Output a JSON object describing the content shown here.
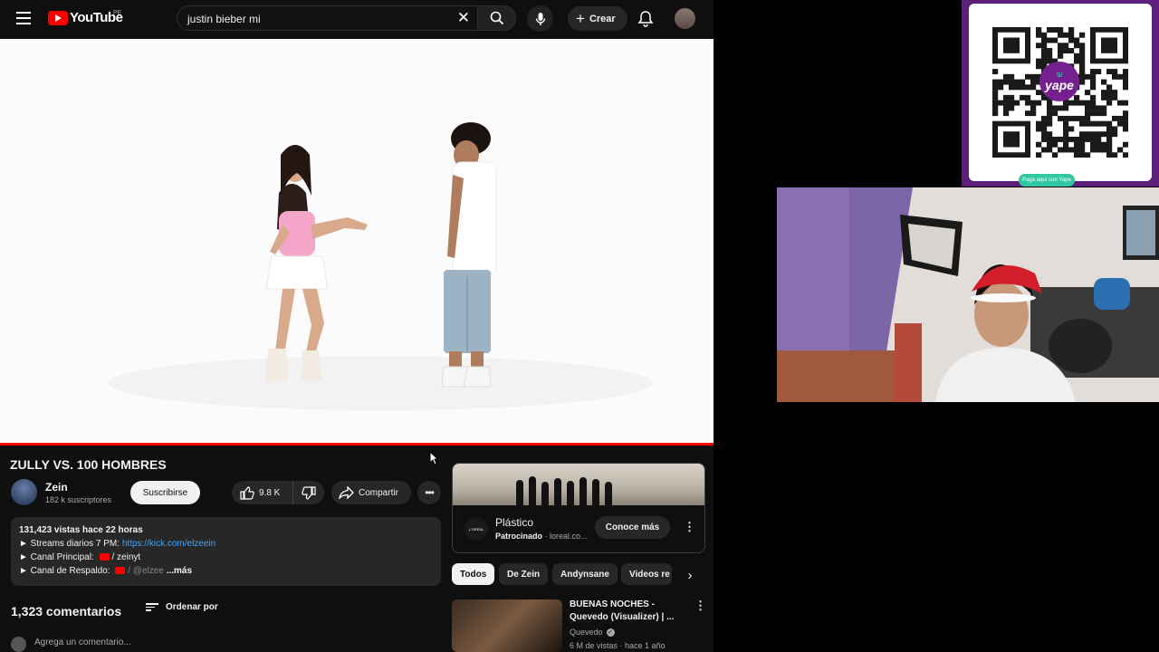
{
  "youtube": {
    "logo_text": "YouTube",
    "region": "PE",
    "search_query": "justin bieber mi",
    "create_label": "Crear",
    "video": {
      "title": "ZULLY VS. 100 HOMBRES",
      "progress_fraction": 1.0
    },
    "channel": {
      "name": "Zein",
      "subscribers": "182 k suscriptores",
      "subscribe_label": "Suscribirse"
    },
    "likes": "9.8 K",
    "share_label": "Compartir",
    "description": {
      "meta": "131,423 vistas  hace 22 horas",
      "streams_prefix": "► Streams diarios 7 PM: ",
      "streams_link": "https://kick.com/elzeein",
      "main_channel_prefix": "► Canal Principal: ",
      "main_channel_handle": "/ zeinyt",
      "backup_prefix": "► Canal de Respaldo: ",
      "backup_handle": "/ @elzee",
      "more_label": "...más"
    },
    "comments": {
      "count": "1,323 comentarios",
      "sort_label": "Ordenar por",
      "placeholder": "Agrega un comentario..."
    },
    "ad": {
      "brand_logo": "L'ORÉAL",
      "title": "Plástico",
      "sponsored": "Patrocinado",
      "domain": "· loreal.co...",
      "cta": "Conoce más"
    },
    "chips": [
      "Todos",
      "De Zein",
      "Andynsane",
      "Videos re"
    ],
    "recommendation": {
      "title": "BUENAS NOCHES - Quevedo (Visualizer) | ...",
      "channel": "Quevedo",
      "meta": "6 M de vistas · hace 1 año"
    }
  },
  "qr": {
    "brand": "yape",
    "currency": "S/",
    "caption": "Paga aquí con Yape"
  },
  "colors": {
    "youtube_red": "#ff0000",
    "link_blue": "#3ea6ff",
    "yape_purple": "#74208e",
    "yape_green": "#30c8a0"
  }
}
